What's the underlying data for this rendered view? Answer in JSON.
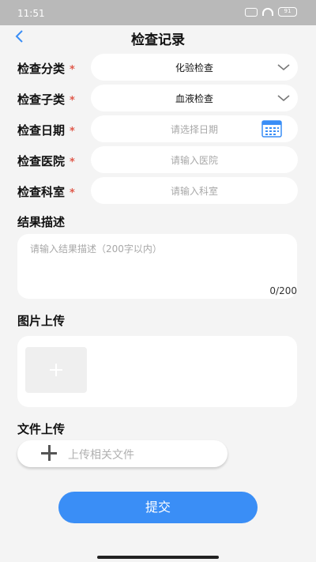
{
  "status": {
    "time": "11:51",
    "battery": "91"
  },
  "nav": {
    "title": "检查记录"
  },
  "form": {
    "rows": [
      {
        "label": "检查分类",
        "value": "化验检查"
      },
      {
        "label": "检查子类",
        "value": "血液检查"
      },
      {
        "label": "检查日期",
        "placeholder": "请选择日期"
      },
      {
        "label": "检查医院",
        "placeholder": "请输入医院"
      },
      {
        "label": "检查科室",
        "placeholder": "请输入科室"
      }
    ],
    "required_mark": "*"
  },
  "result": {
    "title": "结果描述",
    "placeholder": "请输入结果描述（200字以内）",
    "counter": "0/200"
  },
  "image_upload": {
    "title": "图片上传"
  },
  "file_upload": {
    "title": "文件上传",
    "button_label": "上传相关文件"
  },
  "submit_label": "提交",
  "colors": {
    "accent": "#3a8ef6",
    "required": "#e05a4c"
  }
}
